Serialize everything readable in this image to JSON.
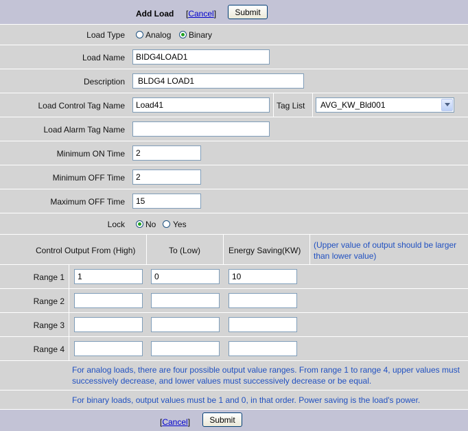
{
  "header": {
    "title": "Add Load",
    "cancel_label": "Cancel",
    "submit_label": "Submit"
  },
  "fields": {
    "load_type": {
      "label": "Load Type",
      "options": [
        "Analog",
        "Binary"
      ],
      "selected": "Binary"
    },
    "load_name": {
      "label": "Load Name",
      "value": "BIDG4LOAD1"
    },
    "description": {
      "label": "Description",
      "value": "BLDG4 LOAD1"
    },
    "control_tag": {
      "label": "Load Control Tag Name",
      "value": "Load41"
    },
    "tag_list": {
      "label": "Tag List",
      "selected": "AVG_KW_Bld001"
    },
    "alarm_tag": {
      "label": "Load Alarm Tag Name",
      "value": ""
    },
    "min_on": {
      "label": "Minimum ON Time",
      "value": "2"
    },
    "min_off": {
      "label": "Minimum OFF Time",
      "value": "2"
    },
    "max_off": {
      "label": "Maximum OFF Time",
      "value": "15"
    },
    "lock": {
      "label": "Lock",
      "options": [
        "No",
        "Yes"
      ],
      "selected": "No"
    }
  },
  "ranges": {
    "col_high": "Control Output From (High)",
    "col_low": "To (Low)",
    "col_energy": "Energy Saving(KW)",
    "hint": "(Upper value of output should be larger than lower value)",
    "rows": [
      {
        "label": "Range 1",
        "high": "1",
        "low": "0",
        "energy": "10"
      },
      {
        "label": "Range 2",
        "high": "",
        "low": "",
        "energy": ""
      },
      {
        "label": "Range 3",
        "high": "",
        "low": "",
        "energy": ""
      },
      {
        "label": "Range 4",
        "high": "",
        "low": "",
        "energy": ""
      }
    ]
  },
  "notes": {
    "analog": "For analog loads, there are four possible output value ranges. From range 1 to range 4, upper values must successively decrease, and lower values must successively decrease or be equal.",
    "binary": "For binary loads, output values must be 1 and 0, in that order. Power saving is the load's power."
  },
  "footer": {
    "cancel_label": "Cancel",
    "submit_label": "Submit"
  }
}
